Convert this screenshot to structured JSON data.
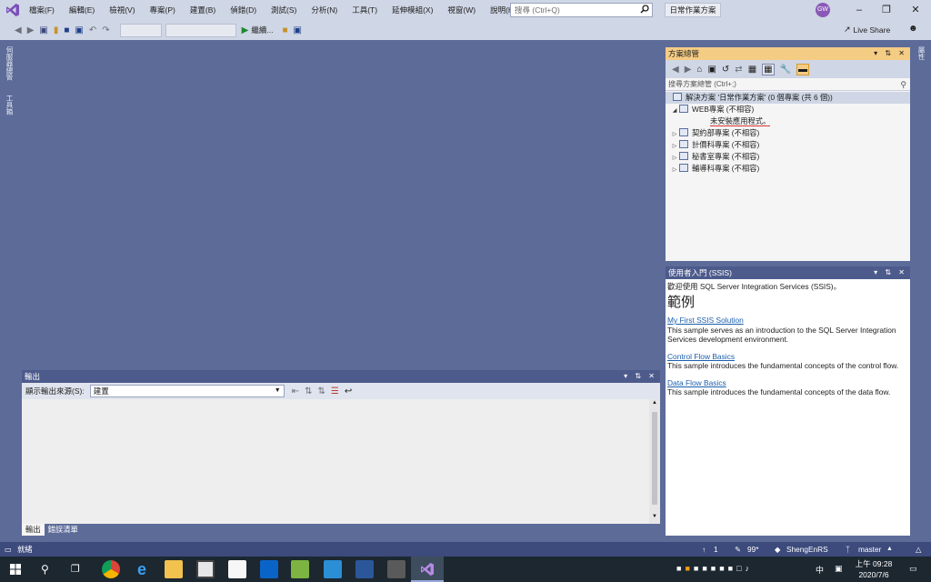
{
  "menu": {
    "items": [
      "檔案(F)",
      "編輯(E)",
      "檢視(V)",
      "專案(P)",
      "建置(B)",
      "偵錯(D)",
      "測試(S)",
      "分析(N)",
      "工具(T)",
      "延伸模組(X)",
      "視窗(W)",
      "說明(H)"
    ]
  },
  "search": {
    "placeholder": "搜尋 (Ctrl+Q)"
  },
  "solution_badge": "日常作業方案",
  "user_avatar": "GW",
  "toolbar": {
    "continue_label": "繼續...",
    "live_share": "Live Share"
  },
  "left_tabs": [
    "伺服器總管",
    "工具箱"
  ],
  "right_tabs": [
    "屬性"
  ],
  "solution_explorer": {
    "title": "方案總管",
    "search_placeholder": "搜尋方案總管 (Ctrl+;)",
    "root": "解決方案 '日常作業方案' (0 個專案 (共 6 個))",
    "projects": [
      {
        "label": "WEB專案 (不相容)",
        "expanded": true,
        "child": "未安裝應用程式。"
      },
      {
        "label": "契約部專案 (不相容)",
        "expanded": false
      },
      {
        "label": "計價科專案 (不相容)",
        "expanded": false
      },
      {
        "label": "秘書室專案 (不相容)",
        "expanded": false
      },
      {
        "label": "輔導科專案 (不相容)",
        "expanded": false
      }
    ]
  },
  "getting_started": {
    "title": "使用者入門 (SSIS)",
    "welcome": "歡迎使用 SQL Server Integration Services (SSIS)。",
    "heading": "範例",
    "samples": [
      {
        "link": "My First SSIS Solution",
        "desc": "This sample serves as an introduction to the SQL Server Integration Services development environment."
      },
      {
        "link": "Control Flow Basics",
        "desc": "This sample introduces the fundamental concepts of the control flow."
      },
      {
        "link": "Data Flow Basics",
        "desc": "This sample introduces the fundamental concepts of the data flow."
      }
    ]
  },
  "output": {
    "title": "輸出",
    "source_label": "顯示輸出來源(S):",
    "source_value": "建置",
    "tabs": [
      "輸出",
      "錯誤清單"
    ]
  },
  "status": {
    "ready": "就緒",
    "up_count": "1",
    "edits": "99*",
    "repo": "ShengEnRS",
    "branch": "master"
  },
  "taskbar": {
    "time": "上午 09:28",
    "date": "2020/7/6",
    "ime": "中"
  },
  "colors": {
    "ide_background": "#5d6b99",
    "chrome": "#cfd6e5",
    "active_panel": "#f5cc84",
    "status_bar": "#3c4a7c",
    "taskbar": "#1c2730",
    "link": "#1b5fae"
  }
}
